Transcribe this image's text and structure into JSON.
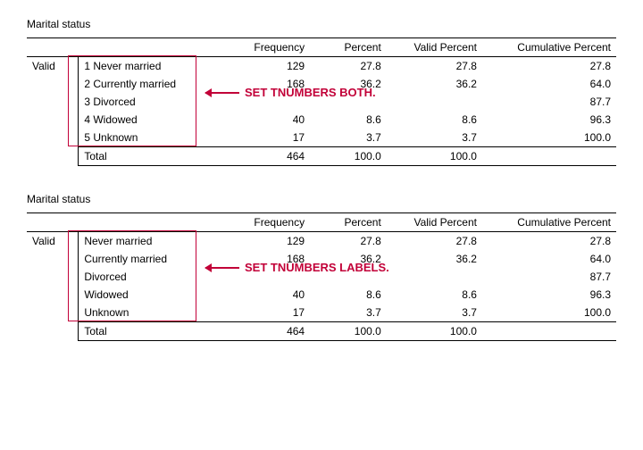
{
  "tables": [
    {
      "title": "Marital status",
      "annotation": "SET TNUMBERS BOTH.",
      "headers": {
        "freq": "Frequency",
        "pct": "Percent",
        "vpct": "Valid Percent",
        "cpct": "Cumulative Percent"
      },
      "valid_label": "Valid",
      "total_label": "Total",
      "rows": [
        {
          "label": "1 Never married",
          "freq": "129",
          "pct": "27.8",
          "vpct": "27.8",
          "cpct": "27.8"
        },
        {
          "label": "2 Currently married",
          "freq": "168",
          "pct": "36.2",
          "vpct": "36.2",
          "cpct": "64.0"
        },
        {
          "label": "3 Divorced",
          "freq": "",
          "pct": "",
          "vpct": "",
          "cpct": "87.7",
          "blank_mid": true
        },
        {
          "label": "4 Widowed",
          "freq": "40",
          "pct": "8.6",
          "vpct": "8.6",
          "cpct": "96.3"
        },
        {
          "label": "5 Unknown",
          "freq": "17",
          "pct": "3.7",
          "vpct": "3.7",
          "cpct": "100.0"
        }
      ],
      "total": {
        "freq": "464",
        "pct": "100.0",
        "vpct": "100.0",
        "cpct": ""
      }
    },
    {
      "title": "Marital status",
      "annotation": "SET TNUMBERS LABELS.",
      "headers": {
        "freq": "Frequency",
        "pct": "Percent",
        "vpct": "Valid Percent",
        "cpct": "Cumulative Percent"
      },
      "valid_label": "Valid",
      "total_label": "Total",
      "rows": [
        {
          "label": "Never married",
          "freq": "129",
          "pct": "27.8",
          "vpct": "27.8",
          "cpct": "27.8"
        },
        {
          "label": "Currently married",
          "freq": "168",
          "pct": "36.2",
          "vpct": "36.2",
          "cpct": "64.0"
        },
        {
          "label": "Divorced",
          "freq": "",
          "pct": "",
          "vpct": "",
          "cpct": "87.7",
          "blank_mid": true
        },
        {
          "label": "Widowed",
          "freq": "40",
          "pct": "8.6",
          "vpct": "8.6",
          "cpct": "96.3"
        },
        {
          "label": "Unknown",
          "freq": "17",
          "pct": "3.7",
          "vpct": "3.7",
          "cpct": "100.0"
        }
      ],
      "total": {
        "freq": "464",
        "pct": "100.0",
        "vpct": "100.0",
        "cpct": ""
      }
    }
  ]
}
